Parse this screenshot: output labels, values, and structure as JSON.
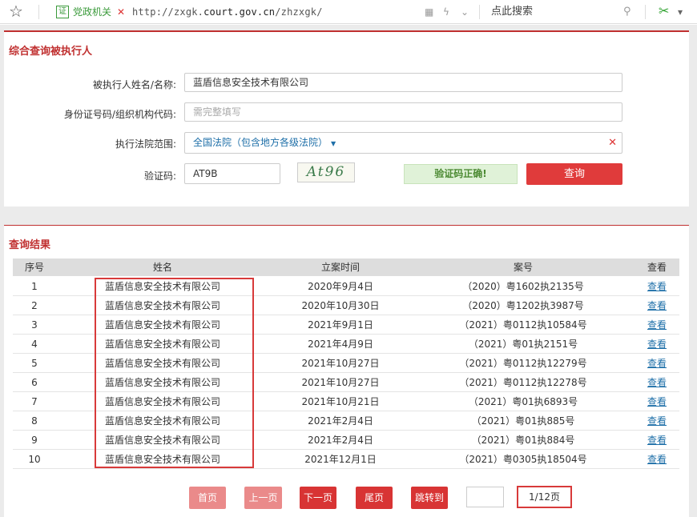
{
  "browser": {
    "gov_badge": "证",
    "gov_label": "党政机关",
    "url_prefix": "http://zxgk.",
    "url_host": "court.gov.cn",
    "url_suffix": "/zhzxgk/",
    "search_placeholder": "点此搜索"
  },
  "query": {
    "title": "综合查询被执行人",
    "name_label": "被执行人姓名/名称:",
    "name_value": "蓝盾信息安全技术有限公司",
    "id_label": "身份证号码/组织机构代码:",
    "id_placeholder": "需完整填写",
    "court_label": "执行法院范围:",
    "court_value": "全国法院（包含地方各级法院）",
    "captcha_label": "验证码:",
    "captcha_value": "AT9B",
    "captcha_image_text": "At96",
    "captcha_ok": "验证码正确!",
    "submit": "查询"
  },
  "results": {
    "title": "查询结果",
    "columns": [
      "序号",
      "姓名",
      "立案时间",
      "案号",
      "查看"
    ],
    "rows": [
      {
        "no": "1",
        "name": "蓝盾信息安全技术有限公司",
        "date": "2020年9月4日",
        "case": "（2020）粤1602执2135号",
        "view": "查看"
      },
      {
        "no": "2",
        "name": "蓝盾信息安全技术有限公司",
        "date": "2020年10月30日",
        "case": "（2020）粤1202执3987号",
        "view": "查看"
      },
      {
        "no": "3",
        "name": "蓝盾信息安全技术有限公司",
        "date": "2021年9月1日",
        "case": "（2021）粤0112执10584号",
        "view": "查看"
      },
      {
        "no": "4",
        "name": "蓝盾信息安全技术有限公司",
        "date": "2021年4月9日",
        "case": "（2021）粤01执2151号",
        "view": "查看"
      },
      {
        "no": "5",
        "name": "蓝盾信息安全技术有限公司",
        "date": "2021年10月27日",
        "case": "（2021）粤0112执12279号",
        "view": "查看"
      },
      {
        "no": "6",
        "name": "蓝盾信息安全技术有限公司",
        "date": "2021年10月27日",
        "case": "（2021）粤0112执12278号",
        "view": "查看"
      },
      {
        "no": "7",
        "name": "蓝盾信息安全技术有限公司",
        "date": "2021年10月21日",
        "case": "（2021）粤01执6893号",
        "view": "查看"
      },
      {
        "no": "8",
        "name": "蓝盾信息安全技术有限公司",
        "date": "2021年2月4日",
        "case": "（2021）粤01执885号",
        "view": "查看"
      },
      {
        "no": "9",
        "name": "蓝盾信息安全技术有限公司",
        "date": "2021年2月4日",
        "case": "（2021）粤01执884号",
        "view": "查看"
      },
      {
        "no": "10",
        "name": "蓝盾信息安全技术有限公司",
        "date": "2021年12月1日",
        "case": "（2021）粤0305执18504号",
        "view": "查看"
      }
    ]
  },
  "pagination": {
    "first": "首页",
    "prev": "上一页",
    "next": "下一页",
    "last": "尾页",
    "jump": "跳转到",
    "page_info": "1/12页"
  }
}
